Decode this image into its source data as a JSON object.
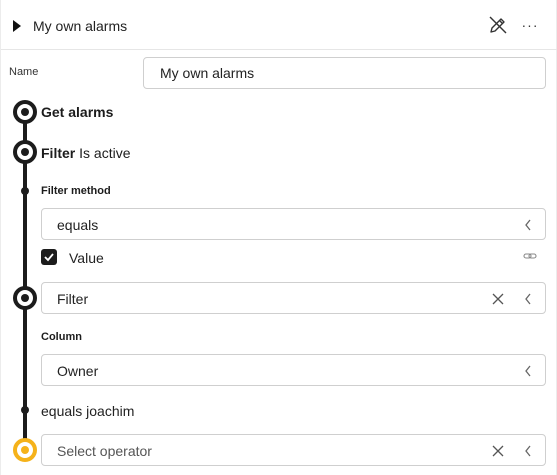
{
  "header": {
    "title": "My own alarms",
    "pencil_icon": "pencil-slash-icon",
    "more_icon": "ellipsis-icon",
    "more_label": "···"
  },
  "name_field": {
    "label": "Name",
    "value": "My own alarms"
  },
  "steps": {
    "get_alarms": {
      "title": "Get alarms"
    },
    "filter": {
      "title": "Filter",
      "subtitle": "Is active"
    }
  },
  "filter_method": {
    "label": "Filter method",
    "value": "equals"
  },
  "value_checkbox": {
    "label": "Value",
    "checked": true
  },
  "filter_field": {
    "value": "Filter"
  },
  "column": {
    "label": "Column",
    "value": "Owner"
  },
  "summary_text": "equals joachim",
  "operator_field": {
    "placeholder": "Select operator"
  },
  "colors": {
    "timeline": "#1c1c1c",
    "active_node": "#f5b21a",
    "border": "#cfcfcf"
  }
}
